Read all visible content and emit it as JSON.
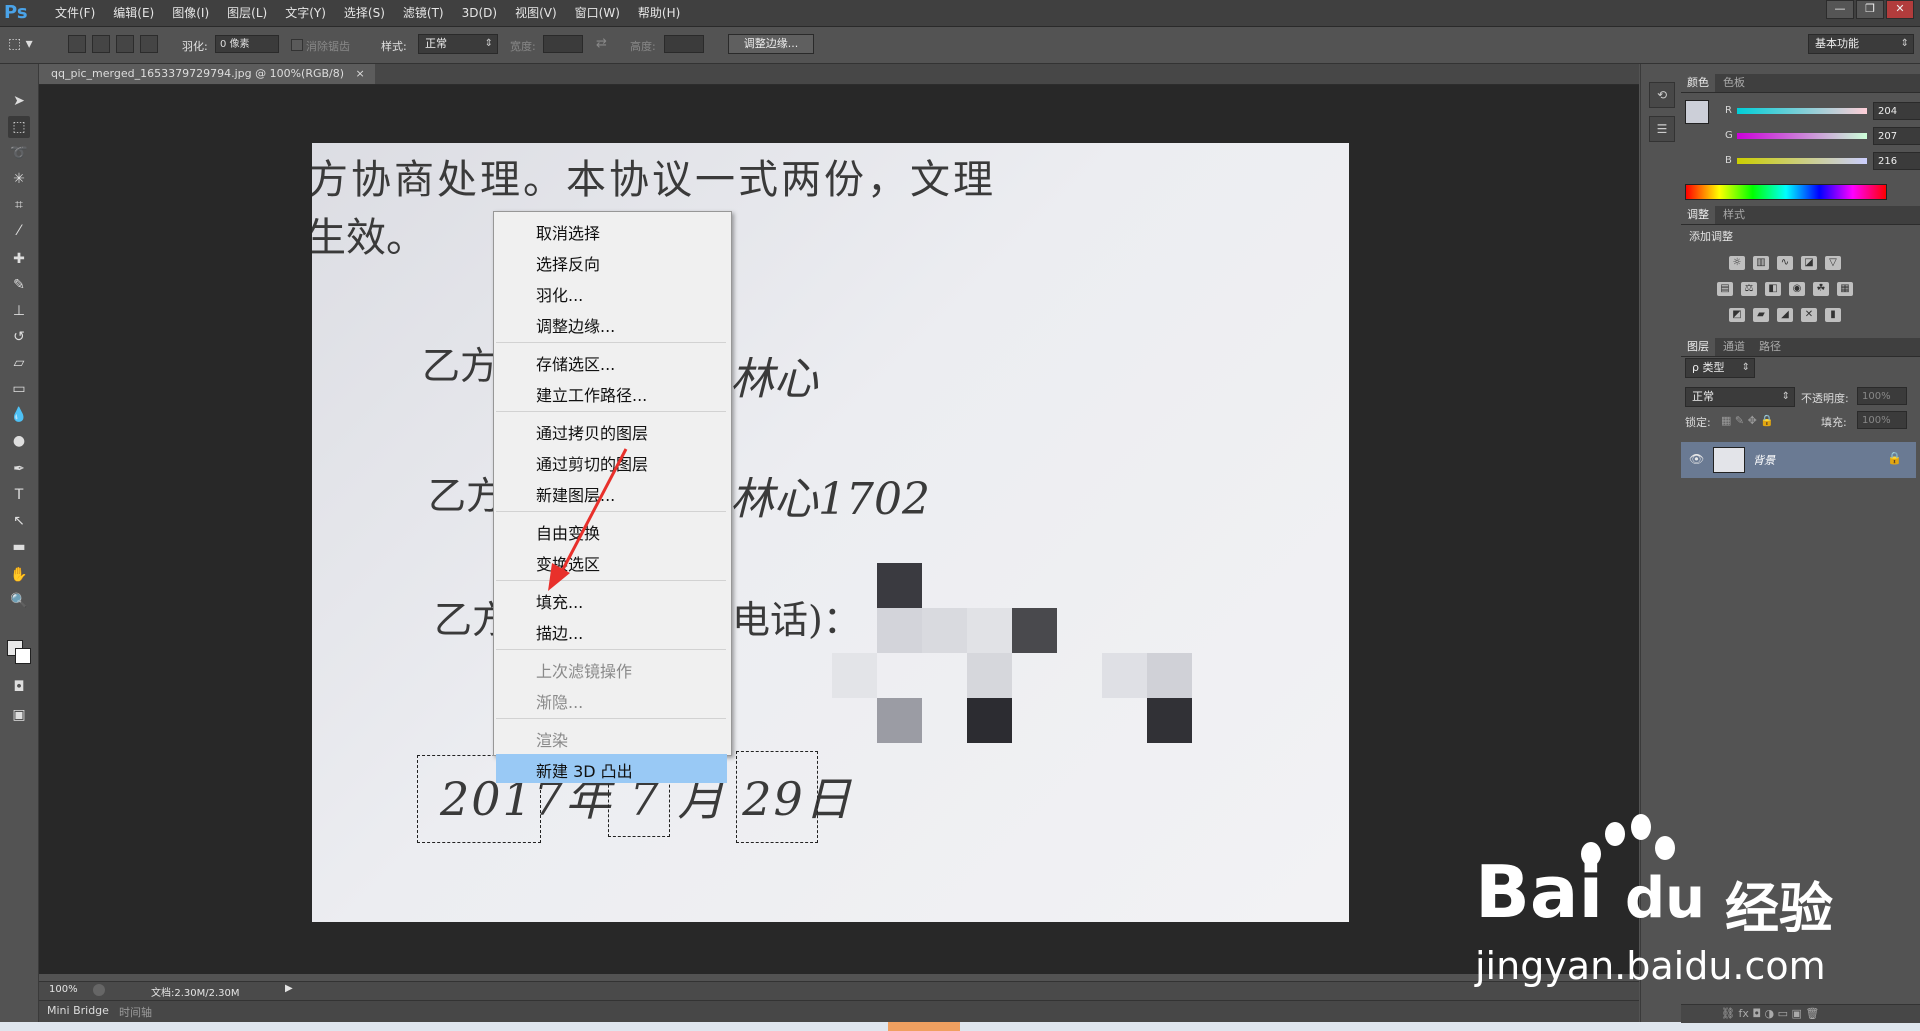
{
  "app": {
    "logo": "Ps",
    "menus": [
      "文件(F)",
      "编辑(E)",
      "图像(I)",
      "图层(L)",
      "文字(Y)",
      "选择(S)",
      "滤镜(T)",
      "3D(D)",
      "视图(V)",
      "窗口(W)",
      "帮助(H)"
    ],
    "window_controls": [
      "—",
      "❐",
      "✕"
    ]
  },
  "options_bar": {
    "feather_label": "羽化:",
    "feather_value": "0 像素",
    "antialias_label": "消除锯齿",
    "style_label": "样式:",
    "style_value": "正常",
    "width_label": "宽度:",
    "height_label": "高度:",
    "refine_button": "调整边缘...",
    "workspace": "基本功能"
  },
  "document": {
    "tab_title": "qq_pic_merged_1653379729794.jpg @ 100%(RGB/8)",
    "tab_close": "×",
    "text_lines": {
      "line1": "方协商处理。本协议一式两份，文理",
      "line2": "生效。",
      "party1": "乙方",
      "party1_sig": "林心",
      "party2": "乙方",
      "party2_sig": "林心1702",
      "party3": "乙方",
      "party3_tail": "电话)：",
      "date": "2017年 7 月 29日"
    }
  },
  "context_menu": {
    "groups": [
      [
        {
          "label": "取消选择",
          "enabled": true
        },
        {
          "label": "选择反向",
          "enabled": true
        },
        {
          "label": "羽化...",
          "enabled": true
        },
        {
          "label": "调整边缘...",
          "enabled": true
        }
      ],
      [
        {
          "label": "存储选区...",
          "enabled": true
        },
        {
          "label": "建立工作路径...",
          "enabled": true
        }
      ],
      [
        {
          "label": "通过拷贝的图层",
          "enabled": true
        },
        {
          "label": "通过剪切的图层",
          "enabled": true
        },
        {
          "label": "新建图层...",
          "enabled": true
        }
      ],
      [
        {
          "label": "自由变换",
          "enabled": true
        },
        {
          "label": "变换选区",
          "enabled": true
        }
      ],
      [
        {
          "label": "填充...",
          "enabled": true
        },
        {
          "label": "描边...",
          "enabled": true
        }
      ],
      [
        {
          "label": "上次滤镜操作",
          "enabled": false
        },
        {
          "label": "渐隐...",
          "enabled": false
        }
      ],
      [
        {
          "label": "渲染",
          "enabled": false
        },
        {
          "label": "新建 3D 凸出",
          "enabled": true,
          "highlighted": true
        }
      ]
    ],
    "highlight_color": "#99c9f5"
  },
  "status_bar": {
    "zoom": "100%",
    "doc_info": "文档:2.30M/2.30M",
    "arrow": "▶"
  },
  "bottom_tabs": [
    "Mini Bridge",
    "时间轴"
  ],
  "panels": {
    "color": {
      "tabs": [
        "颜色",
        "色板"
      ],
      "channels": [
        {
          "name": "R",
          "value": "204"
        },
        {
          "name": "G",
          "value": "207"
        },
        {
          "name": "B",
          "value": "216"
        }
      ],
      "foreground": "#cccfd8"
    },
    "adjustments": {
      "tabs": [
        "调整",
        "样式"
      ],
      "title": "添加调整"
    },
    "layers": {
      "tabs": [
        "图层",
        "通道",
        "路径"
      ],
      "filter_label": "ρ 类型",
      "blend_mode": "正常",
      "opacity_label": "不透明度:",
      "opacity_value": "100%",
      "lock_label": "锁定:",
      "fill_label": "填充:",
      "fill_value": "100%",
      "layer_name": "背景"
    }
  },
  "watermark": {
    "brand": "Bai",
    "brand2": "du",
    "brand_cn": "经验",
    "url": "jingyan.baidu.com"
  },
  "colors": {
    "accent_red_arrow": "#e8302b",
    "ps_blue": "#4aa3e8"
  }
}
